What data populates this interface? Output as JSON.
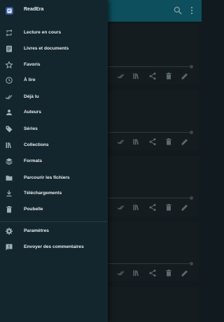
{
  "app": {
    "name": "ReadEra",
    "logo_icon": "readera-logo-icon",
    "accent": "#0d4f5c",
    "drawer_bg": "#14262d",
    "content_bg": "#111a1e"
  },
  "app_bar": {
    "actions": [
      "search-icon",
      "more-vert-icon"
    ]
  },
  "drawer": {
    "items": [
      {
        "label": "Lecture en cours",
        "icon": "repeat-icon"
      },
      {
        "label": "Livres et documents",
        "icon": "book-icon"
      },
      {
        "label": "Favoris",
        "icon": "star-outline-icon"
      },
      {
        "label": "À lire",
        "icon": "clock-icon"
      },
      {
        "label": "Déjà lu",
        "icon": "double-check-icon"
      },
      {
        "label": "Auteurs",
        "icon": "person-icon"
      },
      {
        "label": "Séries",
        "icon": "tag-icon"
      },
      {
        "label": "Collections",
        "icon": "collections-icon"
      },
      {
        "label": "Formats",
        "icon": "layers-icon"
      },
      {
        "label": "Parcourir les fichiers",
        "icon": "folder-icon"
      },
      {
        "label": "Téléchargements",
        "icon": "download-icon"
      },
      {
        "label": "Poubelle",
        "icon": "trash-icon"
      }
    ],
    "footer_items": [
      {
        "label": "Paramètres",
        "icon": "gear-icon"
      },
      {
        "label": "Envoyer des commentaires",
        "icon": "feedback-icon"
      }
    ]
  },
  "card_tools": [
    "double-check-icon",
    "collections-icon",
    "share-icon",
    "trash-icon",
    "edit-icon"
  ]
}
